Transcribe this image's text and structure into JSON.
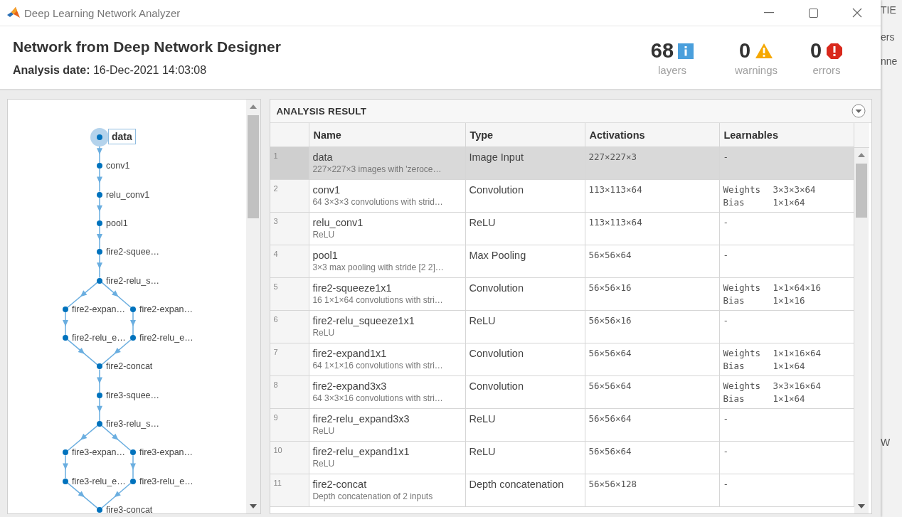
{
  "window": {
    "title": "Deep Learning Network Analyzer"
  },
  "header": {
    "title": "Network from Deep Network Designer",
    "date_label": "Analysis date:",
    "date_value": "16-Dec-2021 14:03:08"
  },
  "stats": [
    {
      "kind": "info",
      "value": "68",
      "label": "layers"
    },
    {
      "kind": "warning",
      "value": "0",
      "label": "warnings"
    },
    {
      "kind": "error",
      "value": "0",
      "label": "errors"
    }
  ],
  "graph": {
    "nodes": [
      {
        "label": "data",
        "kind": "center",
        "selected": true
      },
      {
        "label": "conv1",
        "kind": "center",
        "selected": false
      },
      {
        "label": "relu_conv1",
        "kind": "center",
        "selected": false
      },
      {
        "label": "pool1",
        "kind": "center",
        "selected": false
      },
      {
        "label": "fire2-squee…",
        "kind": "center",
        "selected": false
      },
      {
        "label": "fire2-relu_s…",
        "kind": "center",
        "selected": false
      },
      {
        "label": "fire2-expan…",
        "kind": "left",
        "selected": false
      },
      {
        "label": "fire2-expan…",
        "kind": "right",
        "selected": false
      },
      {
        "label": "fire2-relu_e…",
        "kind": "left",
        "selected": false
      },
      {
        "label": "fire2-relu_e…",
        "kind": "right",
        "selected": false
      },
      {
        "label": "fire2-concat",
        "kind": "center",
        "selected": false
      },
      {
        "label": "fire3-squee…",
        "kind": "center",
        "selected": false
      },
      {
        "label": "fire3-relu_s…",
        "kind": "center",
        "selected": false
      },
      {
        "label": "fire3-expan…",
        "kind": "left",
        "selected": false
      },
      {
        "label": "fire3-expan…",
        "kind": "right",
        "selected": false
      },
      {
        "label": "fire3-relu_e…",
        "kind": "left",
        "selected": false
      },
      {
        "label": "fire3-relu_e…",
        "kind": "right",
        "selected": false
      },
      {
        "label": "fire3-concat",
        "kind": "center",
        "selected": false
      }
    ]
  },
  "analysis": {
    "title": "ANALYSIS RESULT",
    "columns": [
      "Name",
      "Type",
      "Activations",
      "Learnables"
    ],
    "rows": [
      {
        "index": "1",
        "name": "data",
        "description": "227×227×3 images with 'zeroce…",
        "type": "Image Input",
        "activations": "227×227×3",
        "learnables": [],
        "selected": true
      },
      {
        "index": "2",
        "name": "conv1",
        "description": "64 3×3×3 convolutions with strid…",
        "type": "Convolution",
        "activations": "113×113×64",
        "learnables": [
          {
            "name": "Weights",
            "size": "3×3×3×64"
          },
          {
            "name": "Bias",
            "size": "1×1×64"
          }
        ],
        "selected": false
      },
      {
        "index": "3",
        "name": "relu_conv1",
        "description": "ReLU",
        "type": "ReLU",
        "activations": "113×113×64",
        "learnables": [],
        "selected": false
      },
      {
        "index": "4",
        "name": "pool1",
        "description": "3×3 max pooling with stride [2 2]…",
        "type": "Max Pooling",
        "activations": "56×56×64",
        "learnables": [],
        "selected": false
      },
      {
        "index": "5",
        "name": "fire2-squeeze1x1",
        "description": "16 1×1×64 convolutions with stri…",
        "type": "Convolution",
        "activations": "56×56×16",
        "learnables": [
          {
            "name": "Weights",
            "size": "1×1×64×16"
          },
          {
            "name": "Bias",
            "size": "1×1×16"
          }
        ],
        "selected": false
      },
      {
        "index": "6",
        "name": "fire2-relu_squeeze1x1",
        "description": "ReLU",
        "type": "ReLU",
        "activations": "56×56×16",
        "learnables": [],
        "selected": false
      },
      {
        "index": "7",
        "name": "fire2-expand1x1",
        "description": "64 1×1×16 convolutions with stri…",
        "type": "Convolution",
        "activations": "56×56×64",
        "learnables": [
          {
            "name": "Weights",
            "size": "1×1×16×64"
          },
          {
            "name": "Bias",
            "size": "1×1×64"
          }
        ],
        "selected": false
      },
      {
        "index": "8",
        "name": "fire2-expand3x3",
        "description": "64 3×3×16 convolutions with stri…",
        "type": "Convolution",
        "activations": "56×56×64",
        "learnables": [
          {
            "name": "Weights",
            "size": "3×3×16×64"
          },
          {
            "name": "Bias",
            "size": "1×1×64"
          }
        ],
        "selected": false
      },
      {
        "index": "9",
        "name": "fire2-relu_expand3x3",
        "description": "ReLU",
        "type": "ReLU",
        "activations": "56×56×64",
        "learnables": [],
        "selected": false
      },
      {
        "index": "10",
        "name": "fire2-relu_expand1x1",
        "description": "ReLU",
        "type": "ReLU",
        "activations": "56×56×64",
        "learnables": [],
        "selected": false
      },
      {
        "index": "11",
        "name": "fire2-concat",
        "description": "Depth concatenation of 2 inputs",
        "type": "Depth concatenation",
        "activations": "56×56×128",
        "learnables": [],
        "selected": false
      }
    ],
    "empty_marker": "-"
  },
  "background_window": {
    "texts": [
      "TIE",
      "ers",
      "nne",
      "W"
    ]
  }
}
